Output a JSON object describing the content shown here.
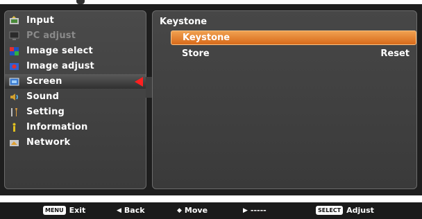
{
  "menu": {
    "items": [
      {
        "label": "Input",
        "icon": "input-icon",
        "disabled": false,
        "active": false
      },
      {
        "label": "PC adjust",
        "icon": "pc-adjust-icon",
        "disabled": true,
        "active": false
      },
      {
        "label": "Image select",
        "icon": "image-select-icon",
        "disabled": false,
        "active": false
      },
      {
        "label": "Image adjust",
        "icon": "image-adjust-icon",
        "disabled": false,
        "active": false
      },
      {
        "label": "Screen",
        "icon": "screen-icon",
        "disabled": false,
        "active": true
      },
      {
        "label": "Sound",
        "icon": "sound-icon",
        "disabled": false,
        "active": false
      },
      {
        "label": "Setting",
        "icon": "setting-icon",
        "disabled": false,
        "active": false
      },
      {
        "label": "Information",
        "icon": "information-icon",
        "disabled": false,
        "active": false
      },
      {
        "label": "Network",
        "icon": "network-icon",
        "disabled": false,
        "active": false
      }
    ]
  },
  "submenu": {
    "title": "Keystone",
    "rows": [
      {
        "label": "Keystone",
        "value": "",
        "selected": true
      },
      {
        "label": "Store",
        "value": "Reset",
        "selected": false
      }
    ]
  },
  "footer": {
    "hints": [
      {
        "key": "MENU",
        "label": "Exit"
      },
      {
        "glyph": "◀",
        "label": "Back"
      },
      {
        "glyph": "◆",
        "label": "Move"
      },
      {
        "glyph": "▶",
        "label": "-----"
      },
      {
        "key": "SELECT",
        "label": "Adjust"
      }
    ]
  },
  "colors": {
    "highlight": "#e07a2a",
    "active_arrow": "#ff2020",
    "panel": "#404040",
    "background": "#1e1e1e"
  }
}
